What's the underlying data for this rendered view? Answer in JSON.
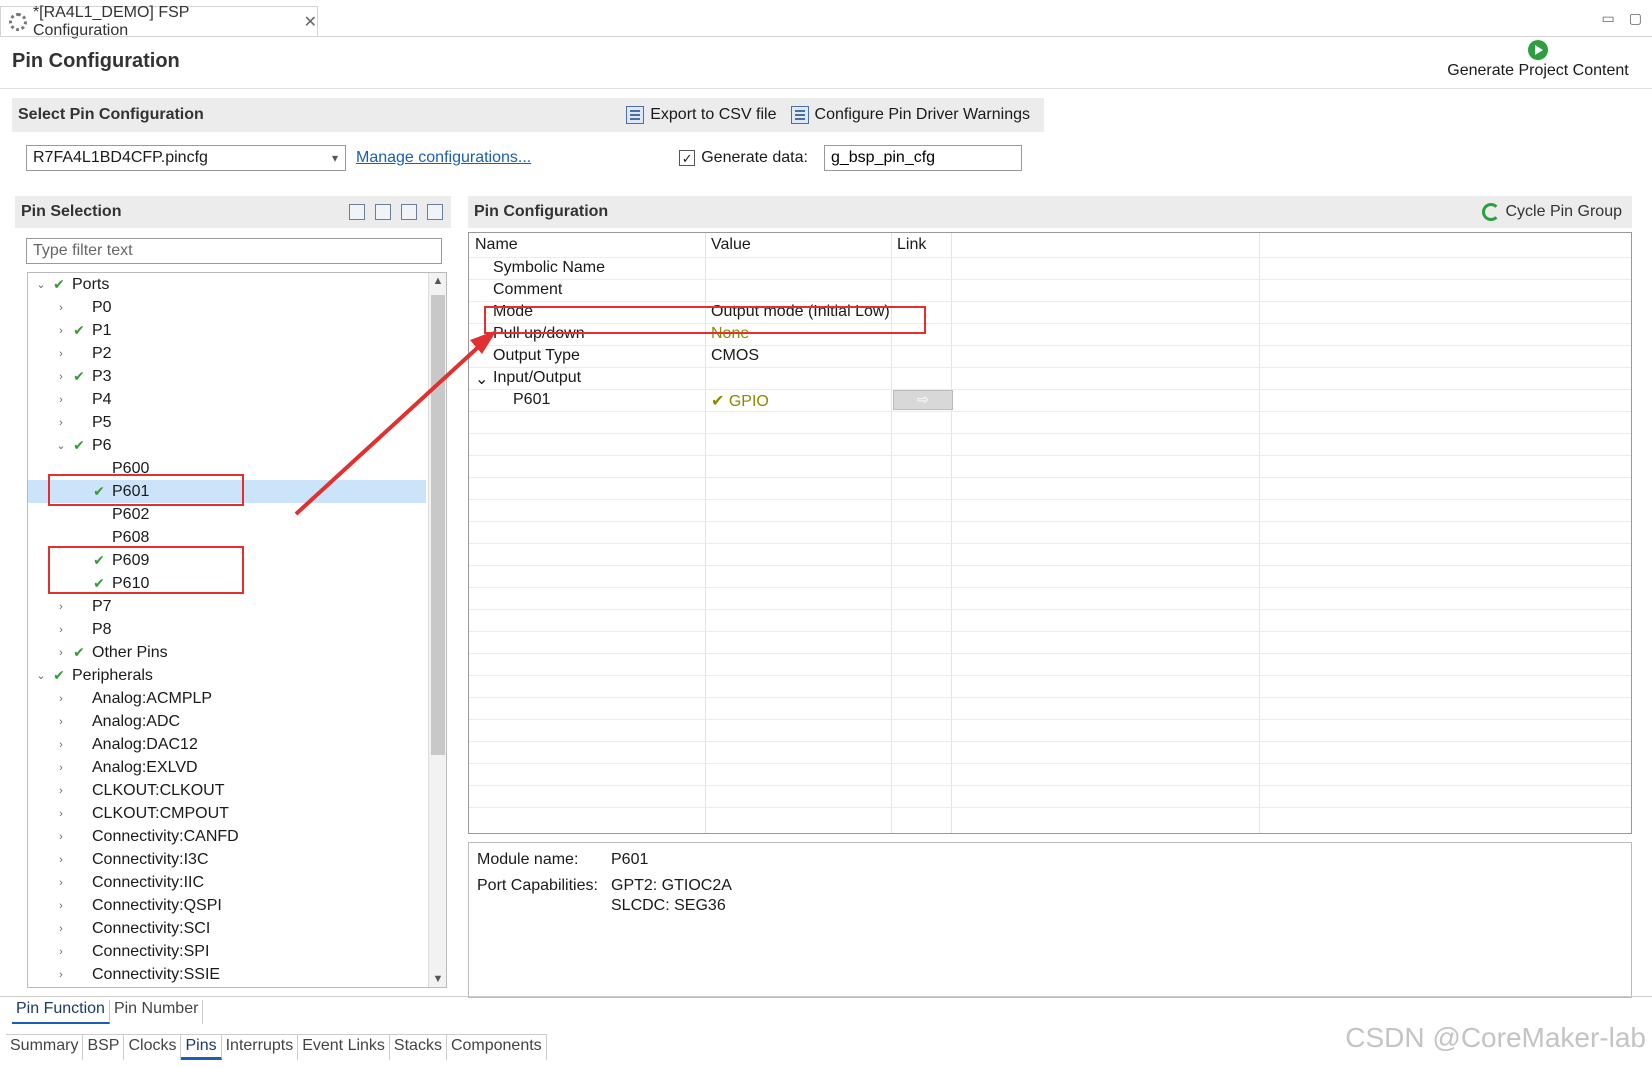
{
  "editor_tab": {
    "title": "*[RA4L1_DEMO] FSP Configuration",
    "close": "✕"
  },
  "window_controls": {
    "minimize": "▭",
    "maximize": "▢"
  },
  "page_title": "Pin Configuration",
  "generate_button": {
    "label": "Generate Project Content"
  },
  "select_bar": {
    "header": "Select Pin Configuration",
    "export_label": "Export to CSV file",
    "warnings_label": "Configure Pin Driver Warnings"
  },
  "config": {
    "selected": "R7FA4L1BD4CFP.pincfg",
    "manage_link": "Manage configurations...",
    "generate_label": "Generate data:",
    "generate_checked": true,
    "generate_value": "g_bsp_pin_cfg"
  },
  "pin_selection": {
    "header": "Pin Selection",
    "filter_placeholder": "Type filter text",
    "tree": [
      {
        "label": "Ports",
        "level": 0,
        "tw": "v",
        "check": true
      },
      {
        "label": "P0",
        "level": 1,
        "tw": ">",
        "check": false
      },
      {
        "label": "P1",
        "level": 1,
        "tw": ">",
        "check": true
      },
      {
        "label": "P2",
        "level": 1,
        "tw": ">",
        "check": false
      },
      {
        "label": "P3",
        "level": 1,
        "tw": ">",
        "check": true
      },
      {
        "label": "P4",
        "level": 1,
        "tw": ">",
        "check": false
      },
      {
        "label": "P5",
        "level": 1,
        "tw": ">",
        "check": false
      },
      {
        "label": "P6",
        "level": 1,
        "tw": "v",
        "check": true
      },
      {
        "label": "P600",
        "level": 2,
        "tw": "",
        "check": false
      },
      {
        "label": "P601",
        "level": 2,
        "tw": "",
        "check": true,
        "selected": true
      },
      {
        "label": "P602",
        "level": 2,
        "tw": "",
        "check": false
      },
      {
        "label": "P608",
        "level": 2,
        "tw": "",
        "check": false
      },
      {
        "label": "P609",
        "level": 2,
        "tw": "",
        "check": true
      },
      {
        "label": "P610",
        "level": 2,
        "tw": "",
        "check": true
      },
      {
        "label": "P7",
        "level": 1,
        "tw": ">",
        "check": false
      },
      {
        "label": "P8",
        "level": 1,
        "tw": ">",
        "check": false
      },
      {
        "label": "Other Pins",
        "level": 1,
        "tw": ">",
        "check": true
      },
      {
        "label": "Peripherals",
        "level": 0,
        "tw": "v",
        "check": true
      },
      {
        "label": "Analog:ACMPLP",
        "level": 1,
        "tw": ">",
        "check": false
      },
      {
        "label": "Analog:ADC",
        "level": 1,
        "tw": ">",
        "check": false
      },
      {
        "label": "Analog:DAC12",
        "level": 1,
        "tw": ">",
        "check": false
      },
      {
        "label": "Analog:EXLVD",
        "level": 1,
        "tw": ">",
        "check": false
      },
      {
        "label": "CLKOUT:CLKOUT",
        "level": 1,
        "tw": ">",
        "check": false
      },
      {
        "label": "CLKOUT:CMPOUT",
        "level": 1,
        "tw": ">",
        "check": false
      },
      {
        "label": "Connectivity:CANFD",
        "level": 1,
        "tw": ">",
        "check": false
      },
      {
        "label": "Connectivity:I3C",
        "level": 1,
        "tw": ">",
        "check": false
      },
      {
        "label": "Connectivity:IIC",
        "level": 1,
        "tw": ">",
        "check": false
      },
      {
        "label": "Connectivity:QSPI",
        "level": 1,
        "tw": ">",
        "check": false
      },
      {
        "label": "Connectivity:SCI",
        "level": 1,
        "tw": ">",
        "check": false
      },
      {
        "label": "Connectivity:SPI",
        "level": 1,
        "tw": ">",
        "check": false
      },
      {
        "label": "Connectivity:SSIE",
        "level": 1,
        "tw": ">",
        "check": false
      }
    ]
  },
  "pin_config": {
    "header": "Pin Configuration",
    "cycle_label": "Cycle Pin Group",
    "columns": [
      "Name",
      "Value",
      "Link"
    ],
    "rows": [
      {
        "name": "Symbolic Name",
        "value": "",
        "indent": 1
      },
      {
        "name": "Comment",
        "value": "",
        "indent": 1
      },
      {
        "name": "Mode",
        "value": "Output mode (Initial Low)",
        "indent": 1
      },
      {
        "name": "Pull up/down",
        "value": "None",
        "indent": 1,
        "green": true
      },
      {
        "name": "Output Type",
        "value": "CMOS",
        "indent": 1
      },
      {
        "name": "Input/Output",
        "value": "",
        "indent": 1,
        "tw": "v"
      },
      {
        "name": "P601",
        "value": "✔ GPIO",
        "indent": 2,
        "green": true,
        "link": "⇨"
      }
    ]
  },
  "details": {
    "module_key": "Module name:",
    "module_value": "P601",
    "caps_key": "Port Capabilities:",
    "caps_line1": "GPT2: GTIOC2A",
    "caps_line2": "SLCDC: SEG36"
  },
  "sub_tabs": [
    "Pin Function",
    "Pin Number"
  ],
  "bottom_tabs": [
    "Summary",
    "BSP",
    "Clocks",
    "Pins",
    "Interrupts",
    "Event Links",
    "Stacks",
    "Components"
  ],
  "active_bottom_tab": "Pins",
  "watermark": "CSDN @CoreMaker-lab",
  "colors": {
    "highlight": "#e03030",
    "selected_row": "#cce4fa",
    "check": "#3a9a3a",
    "link": "#1a5fb4"
  }
}
